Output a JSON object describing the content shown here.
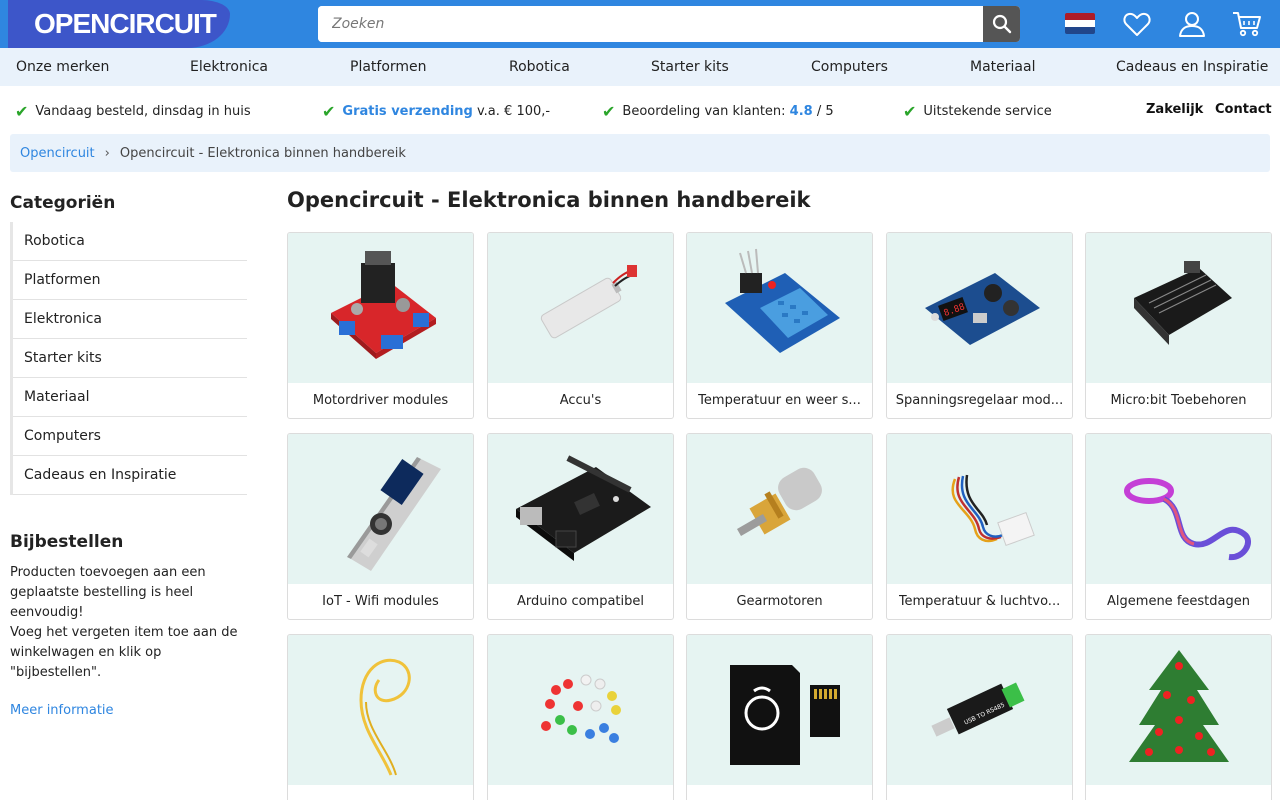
{
  "header": {
    "logo": "OPENCIRCUIT",
    "search_placeholder": "Zoeken",
    "language_flag": "Dutch flag",
    "colors": {
      "topbar": "#2f86e0",
      "logo_bg": "#3d56c9",
      "accent": "#2f86e0"
    }
  },
  "nav": {
    "items": [
      "Onze merken",
      "Elektronica",
      "Platformen",
      "Robotica",
      "Starter kits",
      "Computers",
      "Materiaal",
      "Cadeaus en Inspiratie"
    ]
  },
  "usp": {
    "item1": "Vandaag besteld, dinsdag in huis",
    "item2_link": "Gratis verzending",
    "item2_rest": " v.a. € 100,-",
    "item3_label": "Beoordeling van klanten: ",
    "item3_score": "4.8",
    "item3_suffix": " / 5",
    "item4": "Uitstekende service",
    "link_business": "Zakelijk",
    "link_contact": "Contact"
  },
  "breadcrumb": {
    "home": "Opencircuit",
    "separator": "›",
    "current": "Opencircuit - Elektronica binnen handbereik"
  },
  "sidebar": {
    "title": "Categoriën",
    "items": [
      "Robotica",
      "Platformen",
      "Elektronica",
      "Starter kits",
      "Materiaal",
      "Computers",
      "Cadeaus en Inspiratie"
    ],
    "bij_title": "Bijbestellen",
    "bij_text1": "Producten toevoegen aan een geplaatste bestelling is heel eenvoudig!",
    "bij_text2": "Voeg het vergeten item toe aan de winkelwagen en klik op \"bijbestellen\".",
    "bij_link": "Meer informatie"
  },
  "main": {
    "title": "Opencircuit - Elektronica binnen handbereik",
    "cards": [
      {
        "label": "Motordriver modules",
        "icon": "motor-driver-board"
      },
      {
        "label": "Accu's",
        "icon": "lipo-battery"
      },
      {
        "label": "Temperatuur en weer s...",
        "icon": "temperature-sensor"
      },
      {
        "label": "Spanningsregelaar mod...",
        "icon": "voltage-regulator"
      },
      {
        "label": "Micro:bit Toebehoren",
        "icon": "microbit-connector"
      },
      {
        "label": "IoT - Wifi modules",
        "icon": "iot-board"
      },
      {
        "label": "Arduino compatibel",
        "icon": "arduino-board"
      },
      {
        "label": "Gearmotoren",
        "icon": "gear-motor"
      },
      {
        "label": "Temperatuur & luchtvo...",
        "icon": "humidity-sensor"
      },
      {
        "label": "Algemene feestdagen",
        "icon": "led-strip"
      },
      {
        "label": "",
        "icon": "wire"
      },
      {
        "label": "",
        "icon": "led-assortment"
      },
      {
        "label": "",
        "icon": "sd-card"
      },
      {
        "label": "",
        "icon": "usb-adapter"
      },
      {
        "label": "",
        "icon": "christmas-tree"
      }
    ]
  }
}
